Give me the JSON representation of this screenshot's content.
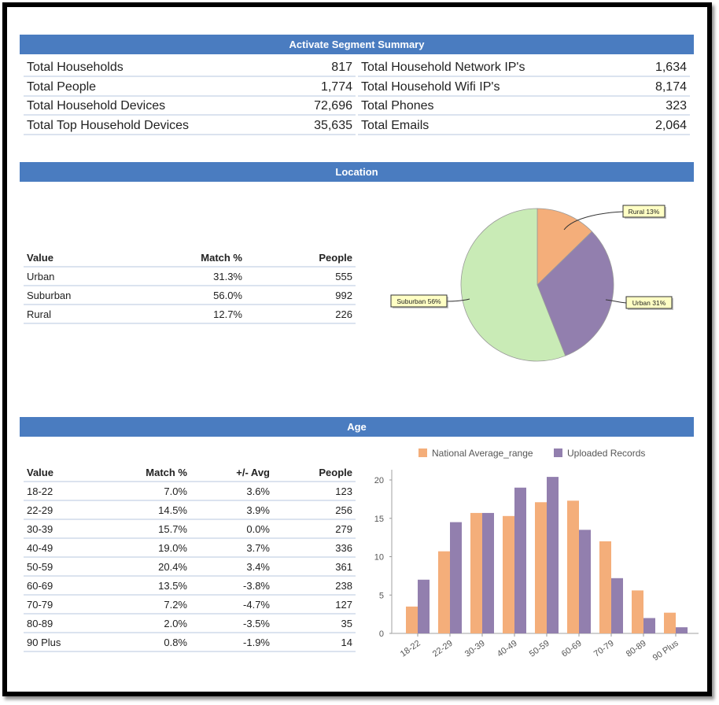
{
  "summary": {
    "title": "Activate Segment Summary",
    "left": [
      {
        "label": "Total Households",
        "value": "817"
      },
      {
        "label": "Total People",
        "value": "1,774"
      },
      {
        "label": "Total Household Devices",
        "value": "72,696"
      },
      {
        "label": "Total Top Household Devices",
        "value": "35,635"
      }
    ],
    "right": [
      {
        "label": "Total Household Network IP's",
        "value": "1,634"
      },
      {
        "label": "Total Household Wifi IP's",
        "value": "8,174"
      },
      {
        "label": "Total Phones",
        "value": "323"
      },
      {
        "label": "Total Emails",
        "value": "2,064"
      }
    ]
  },
  "location": {
    "title": "Location",
    "headers": [
      "Value",
      "Match %",
      "People"
    ],
    "rows": [
      [
        "Urban",
        "31.3%",
        "555"
      ],
      [
        "Suburban",
        "56.0%",
        "992"
      ],
      [
        "Rural",
        "12.7%",
        "226"
      ]
    ]
  },
  "age": {
    "title": "Age",
    "headers": [
      "Value",
      "Match %",
      "+/- Avg",
      "People"
    ],
    "rows": [
      [
        "18-22",
        "7.0%",
        "3.6%",
        "123"
      ],
      [
        "22-29",
        "14.5%",
        "3.9%",
        "256"
      ],
      [
        "30-39",
        "15.7%",
        "0.0%",
        "279"
      ],
      [
        "40-49",
        "19.0%",
        "3.7%",
        "336"
      ],
      [
        "50-59",
        "20.4%",
        "3.4%",
        "361"
      ],
      [
        "60-69",
        "13.5%",
        "-3.8%",
        "238"
      ],
      [
        "70-79",
        "7.2%",
        "-4.7%",
        "127"
      ],
      [
        "80-89",
        "2.0%",
        "-3.5%",
        "35"
      ],
      [
        "90 Plus",
        "0.8%",
        "-1.9%",
        "14"
      ]
    ]
  },
  "colors": {
    "header_bar": "#4a7cc0",
    "rural": "#f4ae7a",
    "urban": "#927fae",
    "suburban": "#c9ebb6",
    "national": "#f4ae7a",
    "uploaded": "#927fae",
    "callout": "#ffffc4"
  },
  "chart_data": [
    {
      "type": "pie",
      "title": "Location",
      "slices": [
        {
          "label": "Rural",
          "value": 12.7,
          "callout": "Rural 13%"
        },
        {
          "label": "Urban",
          "value": 31.3,
          "callout": "Urban 31%"
        },
        {
          "label": "Suburban",
          "value": 56.0,
          "callout": "Suburban 56%"
        }
      ]
    },
    {
      "type": "bar",
      "title": "Age",
      "categories": [
        "18-22",
        "22-29",
        "30-39",
        "40-49",
        "50-59",
        "60-69",
        "70-79",
        "80-89",
        "90 Plus"
      ],
      "series": [
        {
          "name": "National Average_range",
          "values": [
            3.5,
            10.7,
            15.7,
            15.3,
            17.1,
            17.3,
            12.0,
            5.6,
            2.7
          ]
        },
        {
          "name": "Uploaded Records",
          "values": [
            7.0,
            14.5,
            15.7,
            19.0,
            20.4,
            13.5,
            7.2,
            2.0,
            0.8
          ]
        }
      ],
      "yticks": [
        "0",
        "5",
        "10",
        "15",
        "20"
      ],
      "ylim": [
        0,
        20
      ],
      "xlabel": "",
      "ylabel": "",
      "legend": "top",
      "grid": false
    }
  ]
}
